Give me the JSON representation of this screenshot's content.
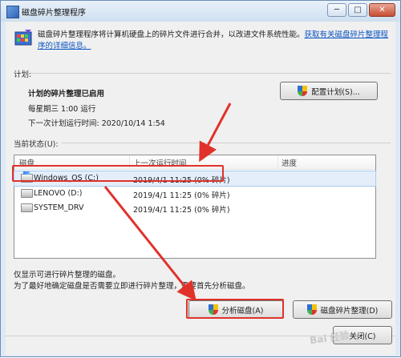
{
  "window": {
    "title": "磁盘碎片整理程序",
    "buttons": {
      "minimize": "─",
      "maximize": "□",
      "close": "✕"
    }
  },
  "header": {
    "description": "磁盘碎片整理程序将计算机硬盘上的碎片文件进行合并，以改进文件系统性能。",
    "link": "获取有关磁盘碎片整理程序的详细信息。"
  },
  "schedule": {
    "section_label": "计划:",
    "title": "计划的碎片整理已启用",
    "run_time": "每星期三  1:00 运行",
    "next_run": "下一次计划运行时间: 2020/10/14 1:54",
    "configure_button": "配置计划(S)..."
  },
  "status": {
    "section_label": "当前状态(U):",
    "columns": [
      "磁盘",
      "上一次运行时间",
      "进度"
    ],
    "rows": [
      {
        "disk": "Windows_OS (C:)",
        "last_run": "2019/4/1 11:25 (0% 碎片)",
        "progress": ""
      },
      {
        "disk": "LENOVO (D:)",
        "last_run": "2019/4/1 11:25 (0% 碎片)",
        "progress": ""
      },
      {
        "disk": "SYSTEM_DRV",
        "last_run": "2019/4/1 11:25 (0% 碎片)",
        "progress": ""
      }
    ]
  },
  "notes": {
    "line1": "仅显示可进行碎片整理的磁盘。",
    "line2": "为了最好地确定磁盘是否需要立即进行碎片整理，需要首先分析磁盘。"
  },
  "actions": {
    "analyze": "分析磁盘(A)",
    "defrag": "磁盘碎片整理(D)",
    "close": "关闭(C)"
  },
  "watermark": "Bai 经验",
  "colors": {
    "highlight": "#e0322a",
    "link": "#0a55c2"
  }
}
